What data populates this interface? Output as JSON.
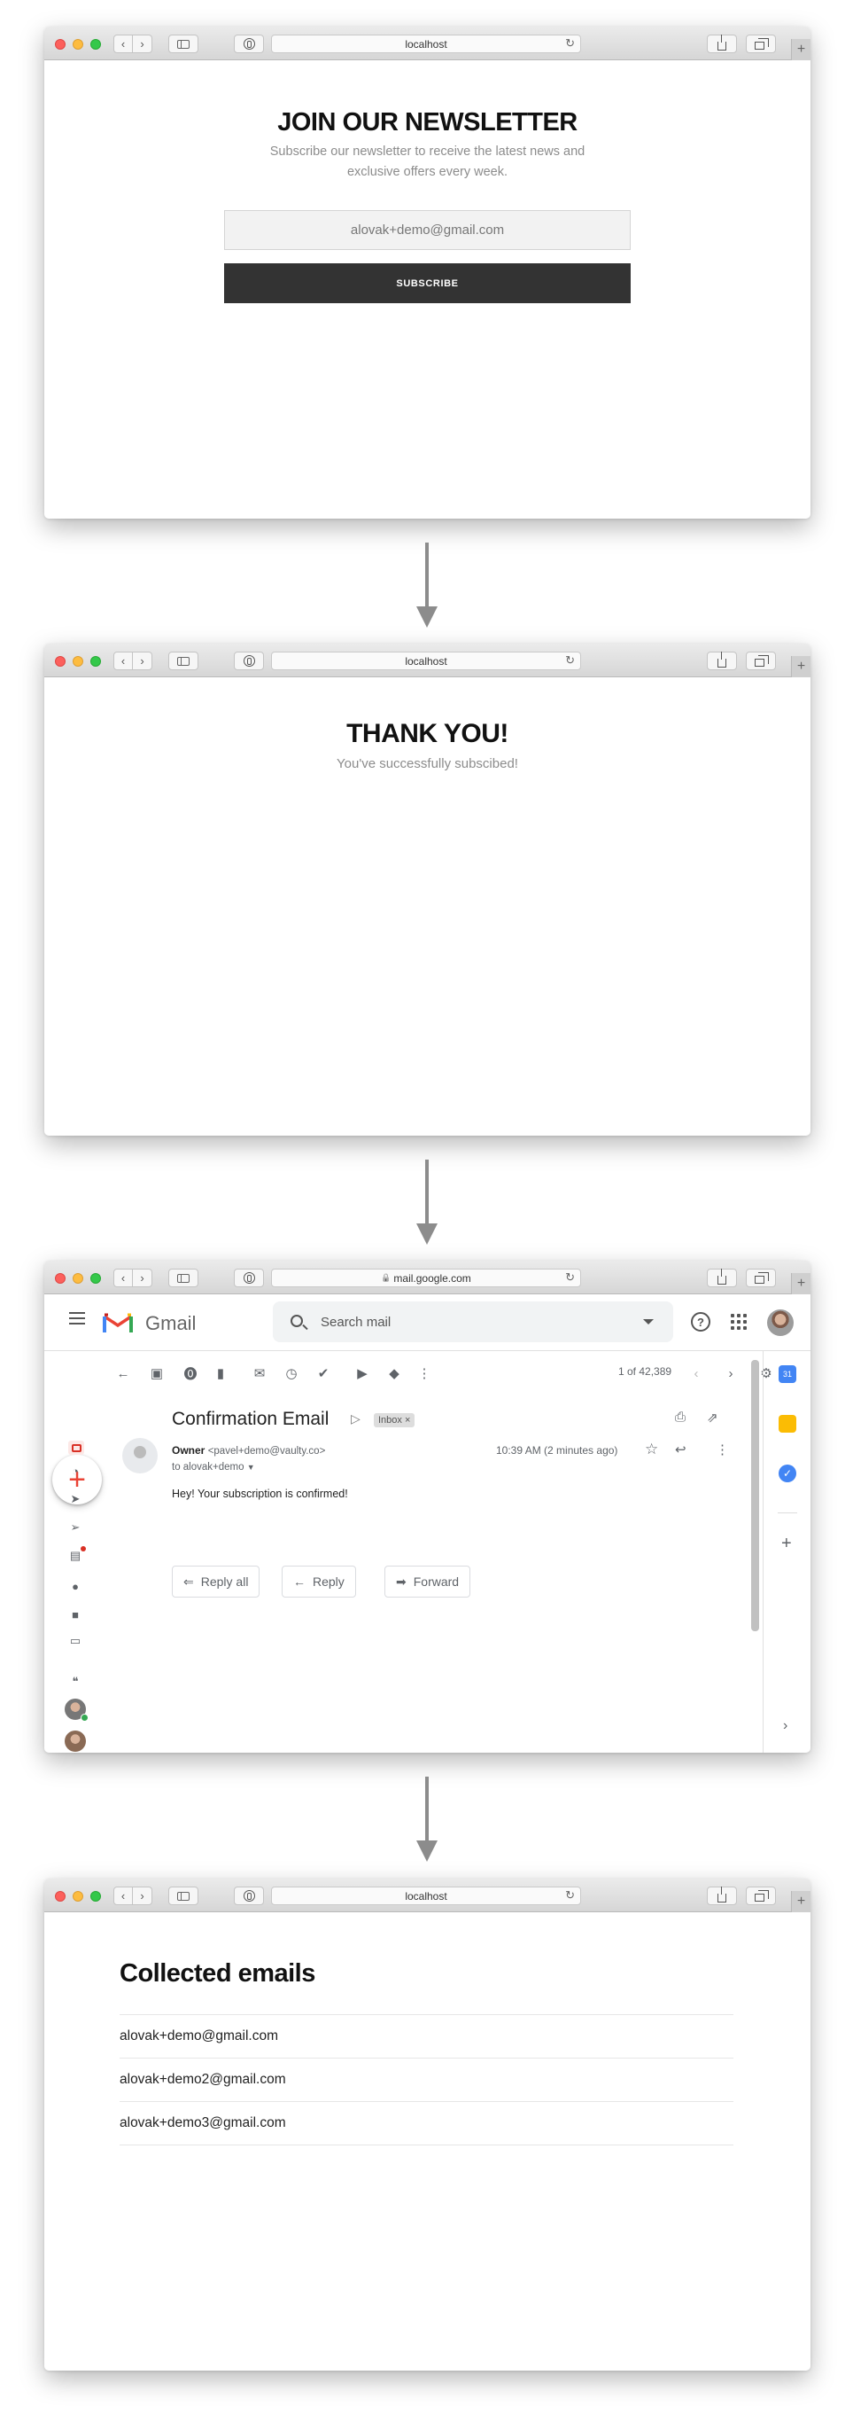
{
  "browser": {
    "url_local": "localhost",
    "url_gmail": "mail.google.com",
    "back_glyph": "‹",
    "forward_glyph": "›",
    "reload_glyph": "↻",
    "new_tab_glyph": "+",
    "lock_glyph": "🔒"
  },
  "newsletter": {
    "title": "JOIN OUR NEWSLETTER",
    "subtitle": "Subscribe our newsletter to receive the latest news and exclusive offers every week.",
    "email_value": "alovak+demo@gmail.com",
    "button_label": "SUBSCRIBE"
  },
  "thankyou": {
    "title": "THANK YOU!",
    "subtitle": "You've successfully subscibed!"
  },
  "gmail": {
    "app_name": "Gmail",
    "search_placeholder": "Search mail",
    "help_glyph": "?",
    "compose_glyph": "+",
    "count": "1 of 42,389",
    "subject": "Confirmation Email",
    "label_badge": "Inbox ×",
    "sender_name": "Owner",
    "sender_email": "<pavel+demo@vaulty.co>",
    "to": "to alovak+demo",
    "time": "10:39 AM (2 minutes ago)",
    "body": "Hey! Your subscription is confirmed!",
    "reply_all": "Reply all",
    "reply": "Reply",
    "forward": "Forward",
    "calendar_day": "31",
    "colors": {
      "red": "#ea4335",
      "blue": "#4285f4",
      "yellow": "#fbbc04",
      "green": "#34a853"
    }
  },
  "collected": {
    "title": "Collected emails",
    "emails": [
      "alovak+demo@gmail.com",
      "alovak+demo2@gmail.com",
      "alovak+demo3@gmail.com"
    ]
  }
}
